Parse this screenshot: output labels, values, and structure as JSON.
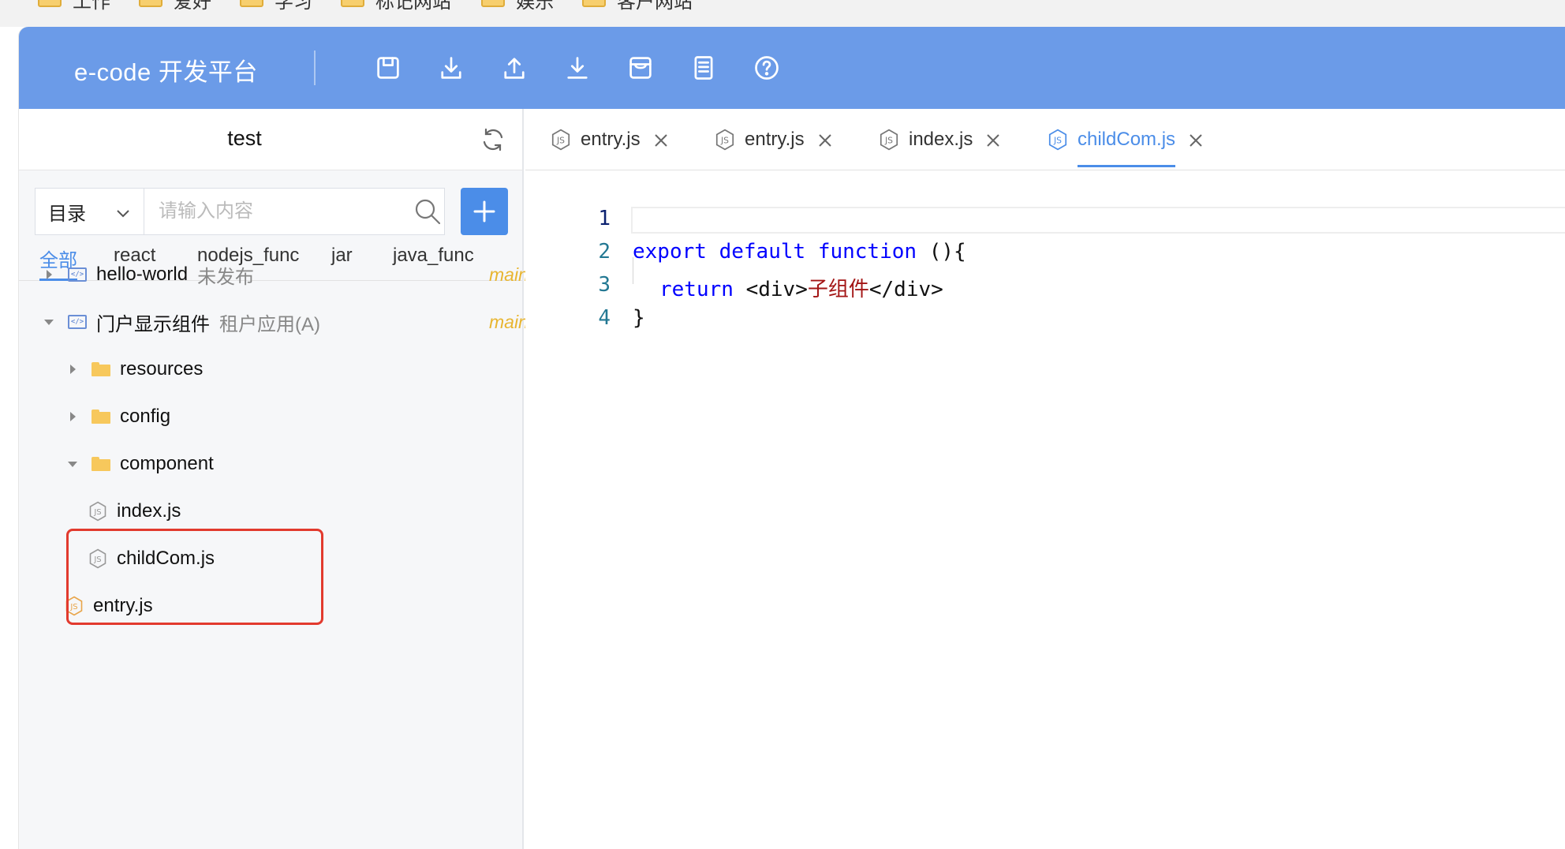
{
  "bookmarks": [
    {
      "label": "工作"
    },
    {
      "label": "爱好"
    },
    {
      "label": "学习"
    },
    {
      "label": "标记网站"
    },
    {
      "label": "娱乐"
    },
    {
      "label": "客户网站"
    }
  ],
  "header": {
    "title": "e-code 开发平台",
    "tools": [
      "save-icon",
      "download-icon",
      "upload-icon",
      "import-icon",
      "store-icon",
      "document-icon",
      "help-icon"
    ]
  },
  "sidebar": {
    "project_name": "test",
    "search": {
      "scope": "目录",
      "placeholder": "请输入内容"
    },
    "categories": [
      {
        "label": "全部",
        "active": true
      },
      {
        "label": "react",
        "active": false
      },
      {
        "label": "nodejs_func",
        "active": false
      },
      {
        "label": "jar",
        "active": false
      },
      {
        "label": "java_func",
        "active": false
      }
    ],
    "tree": {
      "hello_world": {
        "name": "hello-world",
        "status": "未发布",
        "branch": "main"
      },
      "portal": {
        "name": "门户显示组件",
        "status": "租户应用(A)",
        "branch": "main"
      },
      "resources": "resources",
      "config": "config",
      "component": "component",
      "index_js": "index.js",
      "childcom_js": "childCom.js",
      "entry_js": "entry.js"
    }
  },
  "editor": {
    "tabs": [
      {
        "label": "entry.js",
        "active": false
      },
      {
        "label": "entry.js",
        "active": false
      },
      {
        "label": "index.js",
        "active": false
      },
      {
        "label": "childCom.js",
        "active": true
      }
    ],
    "line_numbers": [
      "1",
      "2",
      "3",
      "4"
    ],
    "code": {
      "line2": {
        "kw1": "export",
        "kw2": "default",
        "kw3": "function",
        "rest": " (){"
      },
      "line3": {
        "kw": "return",
        "open": " <div>",
        "str": "子组件",
        "close": "</div>"
      },
      "line4": "}"
    }
  },
  "colors": {
    "header_bg": "#6b9be8",
    "accent": "#4b8de8",
    "branch": "#e8b530",
    "highlight_box": "#e23a2e"
  }
}
